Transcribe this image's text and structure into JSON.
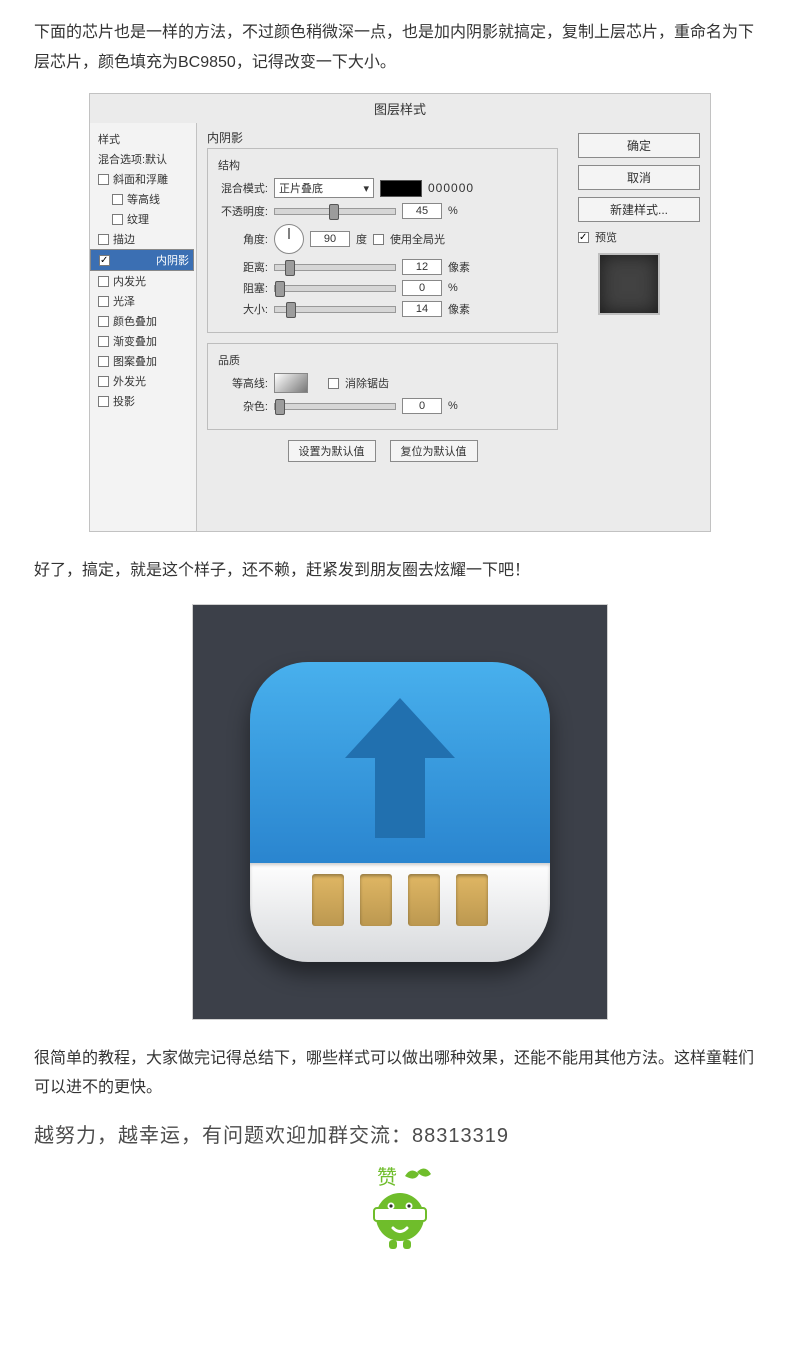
{
  "paragraphs": {
    "p1": "下面的芯片也是一样的方法，不过颜色稍微深一点，也是加内阴影就搞定，复制上层芯片，重命名为下层芯片，颜色填充为BC9850，记得改变一下大小。",
    "p2": "好了，搞定，就是这个样子，还不赖，赶紧发到朋友圈去炫耀一下吧！",
    "p3": "很简单的教程，大家做完记得总结下，哪些样式可以做出哪种效果，还能不能用其他方法。这样童鞋们可以进不的更快。",
    "p4": "越努力，越幸运，有问题欢迎加群交流：88313319"
  },
  "dialog": {
    "title": "图层样式",
    "left_header": "样式",
    "left_sub": "混合选项:默认",
    "items": {
      "bevel": "斜面和浮雕",
      "contour": "等高线",
      "texture": "纹理",
      "stroke": "描边",
      "inner_shadow": "内阴影",
      "inner_glow": "内发光",
      "satin": "光泽",
      "color_overlay": "颜色叠加",
      "grad_overlay": "渐变叠加",
      "pattern_overlay": "图案叠加",
      "outer_glow": "外发光",
      "drop_shadow": "投影"
    },
    "section": "内阴影",
    "group1": "结构",
    "blend_label": "混合模式:",
    "blend_value": "正片叠底",
    "hex": "000000",
    "opacity_label": "不透明度:",
    "opacity_value": "45",
    "pct": "%",
    "angle_label": "角度:",
    "angle_value": "90",
    "deg": "度",
    "global": "使用全局光",
    "distance_label": "距离:",
    "distance_value": "12",
    "px": "像素",
    "spread_label": "阻塞:",
    "spread_value": "0",
    "size_label": "大小:",
    "size_value": "14",
    "group2": "品质",
    "contour_label": "等高线:",
    "anti": "消除锯齿",
    "noise_label": "杂色:",
    "noise_value": "0",
    "btn_default": "设置为默认值",
    "btn_reset": "复位为默认值",
    "ok": "确定",
    "cancel": "取消",
    "new_style": "新建样式...",
    "preview": "预览"
  },
  "mascot_label": "赞"
}
